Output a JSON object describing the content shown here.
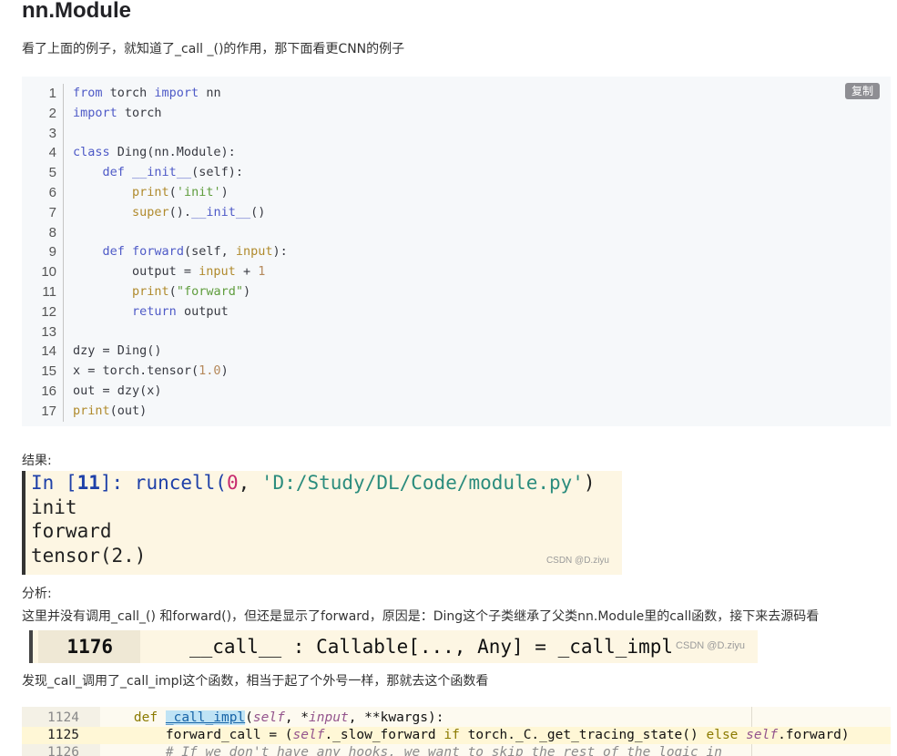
{
  "heading": "nn.Module",
  "intro": "看了上面的例子，就知道了_call _()的作用，那下面看更CNN的例子",
  "code_block": {
    "copy_label": "复制",
    "lines": [
      {
        "n": "1",
        "html": "<span class=\"kw\">from</span> torch <span class=\"kw\">import</span> nn"
      },
      {
        "n": "2",
        "html": "<span class=\"kw\">import</span> torch"
      },
      {
        "n": "3",
        "html": ""
      },
      {
        "n": "4",
        "html": "<span class=\"kw\">class</span> Ding(nn.Module):"
      },
      {
        "n": "5",
        "html": "    <span class=\"kw\">def</span> <span class=\"fn\">__init__</span>(self):"
      },
      {
        "n": "6",
        "html": "        <span class=\"bi\">print</span>(<span class=\"str\">'init'</span>)"
      },
      {
        "n": "7",
        "html": "        <span class=\"bi\">super</span>().<span class=\"fn\">__init__</span>()"
      },
      {
        "n": "8",
        "html": ""
      },
      {
        "n": "9",
        "html": "    <span class=\"kw\">def</span> <span class=\"fn\">forward</span>(self, <span class=\"bi\">input</span>):"
      },
      {
        "n": "10",
        "html": "        output = <span class=\"bi\">input</span> + <span class=\"num\">1</span>"
      },
      {
        "n": "11",
        "html": "        <span class=\"bi\">print</span>(<span class=\"str\">\"forward\"</span>)"
      },
      {
        "n": "12",
        "html": "        <span class=\"kw\">return</span> output"
      },
      {
        "n": "13",
        "html": ""
      },
      {
        "n": "14",
        "html": "dzy = Ding()"
      },
      {
        "n": "15",
        "html": "x = torch.tensor(<span class=\"num\">1.0</span>)"
      },
      {
        "n": "16",
        "html": "out = dzy(x)"
      },
      {
        "n": "17",
        "html": "<span class=\"bi\">print</span>(out)"
      }
    ]
  },
  "result_label": "结果:",
  "console": {
    "in_prompt": "In [",
    "in_num": "11",
    "in_close": "]: runcell(",
    "zero": "0",
    "comma": ", ",
    "path": "'D:/Study/DL/Code/module.py'",
    "paren": ")",
    "out1": "init",
    "out2": "forward",
    "out3": "tensor(2.)",
    "watermark": "CSDN @D.ziyu"
  },
  "analysis_label": "分析:",
  "analysis_text": "这里并没有调用_call_() 和forward()，但还是显示了forward，原因是：Ding这个子类继承了父类nn.Module里的call函数，接下来去源码看",
  "source_strip": {
    "line_no": "1176",
    "text": "__call__ : Callable[..., Any] = _call_impl",
    "watermark": "CSDN @D.ziyu"
  },
  "found_text": "发现_call_调用了_call_impl这个函数，相当于起了个外号一样，那就去这个函数看",
  "ide": {
    "rows": [
      {
        "n": "1124",
        "html": "    <span class=\"ide-kw2\">def</span> <span class=\"ide-fn\">_call_impl</span>(<span class=\"ide-self\">self</span>, *<span class=\"ide-self\">input</span>, **kwargs):"
      },
      {
        "n": "1125",
        "html": "        forward_call = (<span class=\"ide-self\">self</span>._slow_forward <span class=\"ide-kw2\">if</span> torch._C._get_tracing_state() <span class=\"ide-kw2\">else</span> <span class=\"ide-self\">self</span>.forward)"
      },
      {
        "n": "1126",
        "html": "        <span class=\"ide-cm\"># If we don't have any hooks, we want to skip the rest of the logic in</span>"
      }
    ]
  }
}
